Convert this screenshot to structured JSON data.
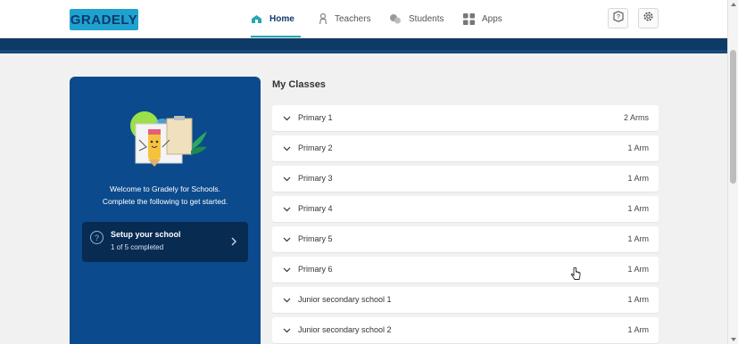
{
  "header": {
    "logo": "GRADELY",
    "nav": [
      {
        "label": "Home",
        "icon": "school-icon",
        "active": true
      },
      {
        "label": "Teachers",
        "icon": "teacher-icon"
      },
      {
        "label": "Students",
        "icon": "students-icon"
      },
      {
        "label": "Apps",
        "icon": "apps-grid-icon"
      }
    ],
    "help_icon": "help-icon",
    "settings_icon": "gear-icon"
  },
  "welcome_panel": {
    "line1": "Welcome to Gradely for Schools.",
    "line2": "Complete the following to get started.",
    "setup": {
      "title": "Setup your school",
      "progress": "1 of 5 completed",
      "icon": "help-circle-icon"
    }
  },
  "classes": {
    "title": "My Classes",
    "items": [
      {
        "name": "Primary 1",
        "arms": "2 Arms"
      },
      {
        "name": "Primary 2",
        "arms": "1 Arm"
      },
      {
        "name": "Primary 3",
        "arms": "1 Arm"
      },
      {
        "name": "Primary 4",
        "arms": "1 Arm"
      },
      {
        "name": "Primary 5",
        "arms": "1 Arm"
      },
      {
        "name": "Primary 6",
        "arms": "1 Arm"
      },
      {
        "name": "Junior secondary school 1",
        "arms": "1 Arm"
      },
      {
        "name": "Junior secondary school 2",
        "arms": "1 Arm"
      }
    ]
  },
  "colors": {
    "brand_blue": "#0b4a8c",
    "logo_bg": "#1fa2cf",
    "active_tab": "#27a6b4"
  }
}
